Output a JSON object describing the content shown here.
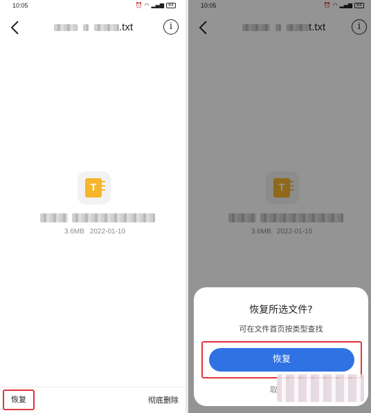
{
  "left_screen": {
    "status": {
      "time": "10:05",
      "battery": "84"
    },
    "title_suffix": ".txt",
    "info_icon": "i",
    "file": {
      "icon_letter": "T",
      "size": "3.6MB",
      "date": "2022-01-10"
    },
    "bottom": {
      "restore_label": "恢复",
      "delete_label": "彻底删除"
    }
  },
  "right_screen": {
    "status": {
      "time": "10:05",
      "battery": "84"
    },
    "title_suffix": "t.txt",
    "info_icon": "i",
    "file": {
      "icon_letter": "T",
      "size": "3.6MB",
      "date": "2022-01-10"
    },
    "dialog": {
      "question": "恢复所选文件?",
      "hint": "可在文件首页按类型查找",
      "confirm_label": "恢复",
      "cancel_label": "取"
    }
  },
  "colors": {
    "accent_blue": "#2f72e4",
    "highlight_red": "#e0343a",
    "file_icon": "#f7b52b"
  }
}
